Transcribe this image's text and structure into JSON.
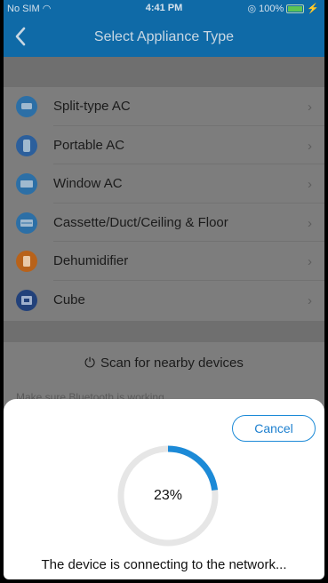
{
  "status": {
    "carrier": "No SIM",
    "time": "4:41 PM",
    "battery": "100%"
  },
  "nav": {
    "title": "Select Appliance Type"
  },
  "appliances": [
    {
      "label": "Split-type AC",
      "icon": "split-ac-icon"
    },
    {
      "label": "Portable AC",
      "icon": "portable-ac-icon"
    },
    {
      "label": "Window AC",
      "icon": "window-ac-icon"
    },
    {
      "label": "Cassette/Duct/Ceiling & Floor",
      "icon": "cassette-ac-icon"
    },
    {
      "label": "Dehumidifier",
      "icon": "dehumidifier-icon"
    },
    {
      "label": "Cube",
      "icon": "cube-icon"
    }
  ],
  "icon_colors": [
    "#2c6fa6",
    "#2c5f9c",
    "#2c6fa6",
    "#2c6fa6",
    "#b8621a",
    "#22417a"
  ],
  "scan": {
    "label": "Scan for nearby devices"
  },
  "hint": "Make sure Bluetooth is working",
  "sheet": {
    "cancel_label": "Cancel",
    "progress_percent": 23,
    "progress_text": "23%",
    "message": "The device is connecting to the network...",
    "accent_color": "#1c8ad7"
  }
}
